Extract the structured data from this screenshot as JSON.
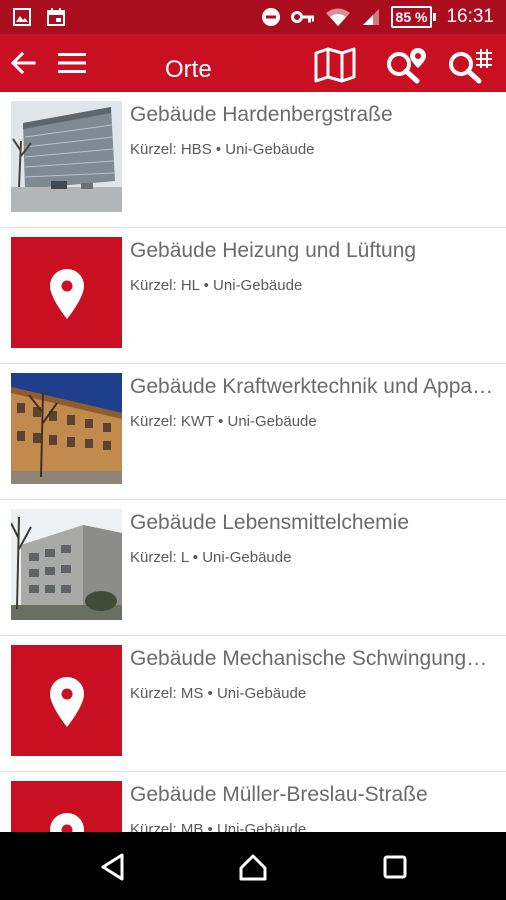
{
  "status_bar": {
    "time": "16:31",
    "battery_percent": "85 %",
    "icons": [
      "image-icon",
      "calendar-icon",
      "do-not-disturb-icon",
      "vpn-key-icon",
      "wifi-icon",
      "signal-icon",
      "battery-icon"
    ]
  },
  "app_bar": {
    "title": "Orte",
    "icons": [
      "back-arrow-icon",
      "hamburger-menu-icon",
      "map-icon",
      "search-location-icon",
      "search-filter-icon"
    ]
  },
  "places": [
    {
      "title": "Gebäude Hardenbergstraße",
      "subtitle": "Kürzel: HBS • Uni-Gebäude",
      "thumbnail": "photo-modern-building"
    },
    {
      "title": "Gebäude Heizung und Lüftung",
      "subtitle": "Kürzel: HL • Uni-Gebäude",
      "thumbnail": "location-pin-icon"
    },
    {
      "title": "Gebäude Kraftwerktechnik und Apparatebau",
      "subtitle": "Kürzel: KWT • Uni-Gebäude",
      "thumbnail": "photo-brick-building"
    },
    {
      "title": "Gebäude Lebensmittelchemie",
      "subtitle": "Kürzel: L • Uni-Gebäude",
      "thumbnail": "photo-grey-building"
    },
    {
      "title": "Gebäude Mechanische Schwingungslehre",
      "subtitle": "Kürzel: MS • Uni-Gebäude",
      "thumbnail": "location-pin-icon"
    },
    {
      "title": "Gebäude Müller-Breslau-Straße",
      "subtitle": "Kürzel: MB • Uni-Gebäude",
      "thumbnail": "location-pin-icon"
    }
  ],
  "colors": {
    "primary": "#c90f22",
    "status_bar": "#a90d1e",
    "title_text": "#6b6b6b",
    "subtitle_text": "#5a5a5a"
  },
  "nav_bar": {
    "icons": [
      "back-triangle-icon",
      "home-icon",
      "recents-icon"
    ]
  }
}
